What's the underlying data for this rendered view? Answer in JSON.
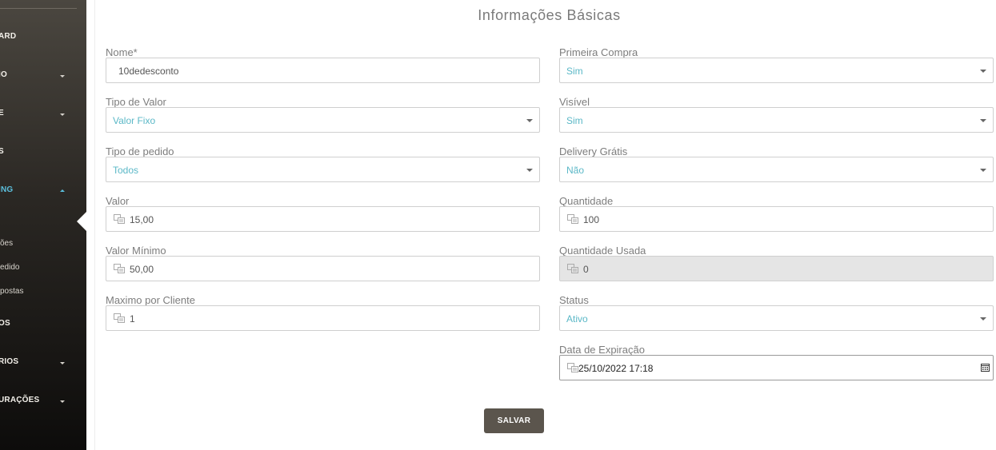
{
  "sidebar": {
    "items": [
      {
        "label": "ARD",
        "caret": false
      },
      {
        "label": "IO",
        "caret": true
      },
      {
        "label": "E",
        "caret": true
      },
      {
        "label": "S",
        "caret": false
      },
      {
        "label": "ING",
        "caret": true,
        "active": true
      },
      {
        "label": "OS",
        "caret": false
      },
      {
        "label": "RIOS",
        "caret": true
      },
      {
        "label": "URAÇÕES",
        "caret": true
      }
    ],
    "subitems": [
      {
        "label": "ões"
      },
      {
        "label": "edido"
      },
      {
        "label": "postas"
      }
    ]
  },
  "form": {
    "title": "Informações Básicas",
    "left": [
      {
        "label": "Nome*",
        "value": "10dedesconto",
        "type": "text-plain"
      },
      {
        "label": "Tipo de Valor",
        "value": "Valor Fixo",
        "type": "select"
      },
      {
        "label": "Tipo de pedido",
        "value": "Todos",
        "type": "select"
      },
      {
        "label": "Valor",
        "value": "15,00",
        "type": "text"
      },
      {
        "label": "Valor Mínimo",
        "value": "50,00",
        "type": "text"
      },
      {
        "label": "Maximo por Cliente",
        "value": "1",
        "type": "text"
      }
    ],
    "right": [
      {
        "label": "Primeira Compra",
        "value": "Sim",
        "type": "select"
      },
      {
        "label": "Visível",
        "value": "Sim",
        "type": "select"
      },
      {
        "label": "Delivery Grátis",
        "value": "Não",
        "type": "select"
      },
      {
        "label": "Quantidade",
        "value": "100",
        "type": "text"
      },
      {
        "label": "Quantidade Usada",
        "value": "0",
        "type": "text-disabled"
      },
      {
        "label": "Status",
        "value": "Ativo",
        "type": "select"
      },
      {
        "label": "Data de Expiração",
        "value": "25/10/2022  17:18",
        "type": "date"
      }
    ],
    "save_label": "SALVAR"
  },
  "colors": {
    "accent": "#5bc0de",
    "select_text": "#5bb8c7",
    "button": "#5b554d"
  }
}
